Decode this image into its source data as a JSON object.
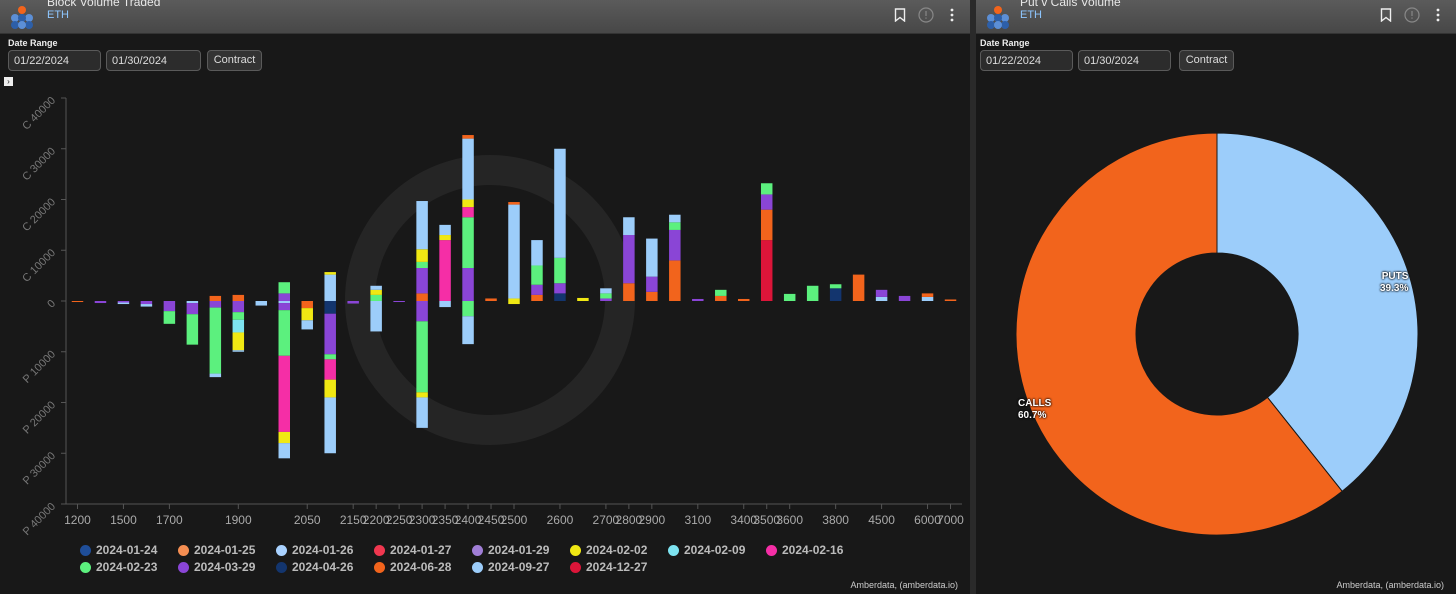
{
  "left_panel": {
    "title": "Block Volume Traded",
    "subtitle": "ETH",
    "date_range_label": "Date Range",
    "start_date": "01/22/2024",
    "end_date": "01/30/2024",
    "contract_button": "Contract",
    "expander": "›",
    "credit": "Amberdata, (amberdata.io)"
  },
  "right_panel": {
    "title": "Put v Calls Volume",
    "subtitle": "ETH",
    "date_range_label": "Date Range",
    "start_date": "01/22/2024",
    "end_date": "01/30/2024",
    "contract_button": "Contract",
    "credit": "Amberdata, (amberdata.io)"
  },
  "icons": [
    "logo-icon",
    "bookmark-icon",
    "info-icon",
    "more-vertical-icon"
  ],
  "chart_data": [
    {
      "type": "bar",
      "stacked": true,
      "ylabel_ticks": [
        "C 40000",
        "C 30000",
        "C 20000",
        "C 10000",
        "0",
        "P 10000",
        "P 20000",
        "P 30000",
        "P 40000"
      ],
      "ylim": [
        -40000,
        40000
      ],
      "categories": [
        "1200",
        "1300",
        "1500",
        "1600",
        "1700",
        "1800",
        "1850",
        "1900",
        "1950",
        "2000",
        "2050",
        "2100",
        "2150",
        "2200",
        "2250",
        "2300",
        "2350",
        "2400",
        "2450",
        "2500",
        "2550",
        "2600",
        "2650",
        "2700",
        "2800",
        "2900",
        "3000",
        "3100",
        "3200",
        "3400",
        "3500",
        "3600",
        "3700",
        "3800",
        "4000",
        "4500",
        "5000",
        "6000",
        "7000"
      ],
      "x_tick_labels": [
        "1200",
        "1500",
        "1700",
        "1900",
        "2050",
        "2150",
        "2200",
        "2250",
        "2300",
        "2350",
        "2400",
        "2450",
        "2500",
        "2600",
        "2700",
        "2800",
        "2900",
        "3100",
        "3400",
        "3500",
        "3600",
        "3800",
        "4500",
        "6000",
        "7000"
      ],
      "expiries": [
        "2024-01-24",
        "2024-01-25",
        "2024-01-26",
        "2024-01-27",
        "2024-01-29",
        "2024-02-02",
        "2024-02-09",
        "2024-02-16",
        "2024-02-23",
        "2024-03-29",
        "2024-04-26",
        "2024-06-28",
        "2024-09-27",
        "2024-12-27"
      ],
      "colors": {
        "2024-01-24": "#1f4e99",
        "2024-01-25": "#f58e52",
        "2024-01-26": "#a9d2ff",
        "2024-01-27": "#f0374f",
        "2024-01-29": "#a07ed6",
        "2024-02-02": "#f0e813",
        "2024-02-09": "#7de3f0",
        "2024-02-16": "#f52ea6",
        "2024-02-23": "#5cf07e",
        "2024-03-29": "#8a45d6",
        "2024-04-26": "#13356e",
        "2024-06-28": "#f2641c",
        "2024-09-27": "#9ccdfa",
        "2024-12-27": "#dc1539"
      },
      "bars": [
        {
          "x": "1200",
          "calls": [],
          "puts": [
            [
              "2024-06-28",
              200
            ]
          ]
        },
        {
          "x": "1300",
          "calls": [],
          "puts": [
            [
              "2024-03-29",
              400
            ]
          ]
        },
        {
          "x": "1500",
          "calls": [],
          "puts": [
            [
              "2024-03-29",
              300
            ],
            [
              "2024-09-27",
              300
            ]
          ]
        },
        {
          "x": "1600",
          "calls": [],
          "puts": [
            [
              "2024-03-29",
              600
            ],
            [
              "2024-09-27",
              500
            ]
          ]
        },
        {
          "x": "1700",
          "calls": [],
          "puts": [
            [
              "2024-03-29",
              2000
            ],
            [
              "2024-02-23",
              2500
            ]
          ]
        },
        {
          "x": "1800",
          "calls": [],
          "puts": [
            [
              "2024-09-27",
              400
            ],
            [
              "2024-03-29",
              2200
            ],
            [
              "2024-02-23",
              6000
            ]
          ]
        },
        {
          "x": "1850",
          "calls": [
            [
              "2024-06-28",
              1000
            ]
          ],
          "puts": [
            [
              "2024-03-29",
              1300
            ],
            [
              "2024-02-23",
              13000
            ],
            [
              "2024-09-27",
              700
            ]
          ]
        },
        {
          "x": "1900",
          "calls": [
            [
              "2024-06-28",
              1200
            ]
          ],
          "puts": [
            [
              "2024-03-29",
              2200
            ],
            [
              "2024-02-23",
              1500
            ],
            [
              "2024-02-09",
              2500
            ],
            [
              "2024-02-02",
              3500
            ],
            [
              "2024-09-27",
              300
            ]
          ]
        },
        {
          "x": "1950",
          "calls": [],
          "puts": [
            [
              "2024-09-27",
              900
            ]
          ]
        },
        {
          "x": "2000",
          "calls": [
            [
              "2024-03-29",
              1500
            ],
            [
              "2024-02-23",
              2200
            ]
          ],
          "puts": [
            [
              "2024-09-27",
              400
            ],
            [
              "2024-03-29",
              1400
            ],
            [
              "2024-02-23",
              9000
            ],
            [
              "2024-02-16",
              15000
            ],
            [
              "2024-02-02",
              2200
            ],
            [
              "2024-09-27",
              3000
            ]
          ]
        },
        {
          "x": "2050",
          "calls": [],
          "puts": [
            [
              "2024-06-28",
              1400
            ],
            [
              "2024-02-02",
              2400
            ],
            [
              "2024-09-27",
              1800
            ]
          ]
        },
        {
          "x": "2100",
          "calls": [
            [
              "2024-09-27",
              5200
            ],
            [
              "2024-02-02",
              500
            ]
          ],
          "puts": [
            [
              "2024-04-26",
              2500
            ],
            [
              "2024-03-29",
              8000
            ],
            [
              "2024-02-23",
              1000
            ],
            [
              "2024-02-16",
              4000
            ],
            [
              "2024-02-02",
              3500
            ],
            [
              "2024-09-27",
              11000
            ]
          ]
        },
        {
          "x": "2150",
          "calls": [],
          "puts": [
            [
              "2024-03-29",
              500
            ]
          ]
        },
        {
          "x": "2200",
          "calls": [
            [
              "2024-02-23",
              1200
            ],
            [
              "2024-02-02",
              1000
            ],
            [
              "2024-09-27",
              800
            ]
          ],
          "puts": [
            [
              "2024-09-27",
              6000
            ]
          ]
        },
        {
          "x": "2250",
          "calls": [],
          "puts": [
            [
              "2024-03-29",
              200
            ]
          ]
        },
        {
          "x": "2300",
          "calls": [
            [
              "2024-06-28",
              1500
            ],
            [
              "2024-03-29",
              5000
            ],
            [
              "2024-02-23",
              1200
            ],
            [
              "2024-02-02",
              2500
            ],
            [
              "2024-09-27",
              9500
            ]
          ],
          "puts": [
            [
              "2024-03-29",
              4000
            ],
            [
              "2024-02-23",
              14000
            ],
            [
              "2024-02-02",
              1000
            ],
            [
              "2024-09-27",
              6000
            ]
          ]
        },
        {
          "x": "2350",
          "calls": [
            [
              "2024-02-16",
              12000
            ],
            [
              "2024-02-02",
              1000
            ],
            [
              "2024-09-27",
              2000
            ]
          ],
          "puts": [
            [
              "2024-09-27",
              1200
            ]
          ]
        },
        {
          "x": "2400",
          "calls": [
            [
              "2024-03-29",
              6500
            ],
            [
              "2024-02-23",
              10000
            ],
            [
              "2024-02-16",
              2000
            ],
            [
              "2024-02-02",
              1500
            ],
            [
              "2024-09-27",
              12000
            ],
            [
              "2024-06-28",
              700
            ]
          ],
          "puts": [
            [
              "2024-02-23",
              3000
            ],
            [
              "2024-09-27",
              5500
            ]
          ]
        },
        {
          "x": "2450",
          "calls": [
            [
              "2024-06-28",
              500
            ]
          ],
          "puts": []
        },
        {
          "x": "2500",
          "calls": [
            [
              "2024-02-02",
              500
            ],
            [
              "2024-09-27",
              18500
            ],
            [
              "2024-06-28",
              500
            ]
          ],
          "puts": [
            [
              "2024-02-02",
              600
            ]
          ]
        },
        {
          "x": "2550",
          "calls": [
            [
              "2024-06-28",
              1200
            ],
            [
              "2024-03-29",
              2000
            ],
            [
              "2024-02-23",
              3800
            ],
            [
              "2024-09-27",
              5000
            ]
          ],
          "puts": []
        },
        {
          "x": "2600",
          "calls": [
            [
              "2024-04-26",
              1500
            ],
            [
              "2024-03-29",
              2000
            ],
            [
              "2024-02-23",
              5000
            ],
            [
              "2024-09-27",
              21500
            ]
          ],
          "puts": []
        },
        {
          "x": "2650",
          "calls": [
            [
              "2024-02-02",
              600
            ]
          ],
          "puts": []
        },
        {
          "x": "2700",
          "calls": [
            [
              "2024-03-29",
              500
            ],
            [
              "2024-02-23",
              1000
            ],
            [
              "2024-09-27",
              1000
            ]
          ],
          "puts": []
        },
        {
          "x": "2800",
          "calls": [
            [
              "2024-06-28",
              3500
            ],
            [
              "2024-03-29",
              9500
            ],
            [
              "2024-09-27",
              3500
            ]
          ],
          "puts": []
        },
        {
          "x": "2900",
          "calls": [
            [
              "2024-06-28",
              1800
            ],
            [
              "2024-03-29",
              3000
            ],
            [
              "2024-09-27",
              7500
            ]
          ],
          "puts": []
        },
        {
          "x": "3000",
          "calls": [
            [
              "2024-06-28",
              8000
            ],
            [
              "2024-03-29",
              6000
            ],
            [
              "2024-02-23",
              1500
            ],
            [
              "2024-09-27",
              1500
            ]
          ],
          "puts": []
        },
        {
          "x": "3100",
          "calls": [
            [
              "2024-03-29",
              400
            ]
          ],
          "puts": []
        },
        {
          "x": "3200",
          "calls": [
            [
              "2024-06-28",
              1000
            ],
            [
              "2024-02-23",
              1200
            ]
          ],
          "puts": []
        },
        {
          "x": "3400",
          "calls": [
            [
              "2024-06-28",
              400
            ]
          ],
          "puts": []
        },
        {
          "x": "3500",
          "calls": [
            [
              "2024-12-27",
              12000
            ],
            [
              "2024-06-28",
              6000
            ],
            [
              "2024-03-29",
              3000
            ],
            [
              "2024-02-23",
              2200
            ]
          ],
          "puts": []
        },
        {
          "x": "3600",
          "calls": [
            [
              "2024-02-23",
              1400
            ]
          ],
          "puts": []
        },
        {
          "x": "3700",
          "calls": [
            [
              "2024-02-23",
              3000
            ]
          ],
          "puts": []
        },
        {
          "x": "3800",
          "calls": [
            [
              "2024-04-26",
              2500
            ],
            [
              "2024-02-23",
              800
            ]
          ],
          "puts": []
        },
        {
          "x": "4000",
          "calls": [
            [
              "2024-06-28",
              5200
            ]
          ],
          "puts": []
        },
        {
          "x": "4500",
          "calls": [
            [
              "2024-09-27",
              800
            ],
            [
              "2024-03-29",
              1400
            ]
          ],
          "puts": []
        },
        {
          "x": "5000",
          "calls": [
            [
              "2024-03-29",
              1000
            ]
          ],
          "puts": []
        },
        {
          "x": "6000",
          "calls": [
            [
              "2024-09-27",
              800
            ],
            [
              "2024-06-28",
              700
            ]
          ],
          "puts": []
        },
        {
          "x": "7000",
          "calls": [
            [
              "2024-06-28",
              300
            ]
          ],
          "puts": []
        }
      ]
    },
    {
      "type": "pie",
      "donut": true,
      "slices": [
        {
          "label": "PUTS",
          "value": 39.3,
          "display": "39.3%",
          "color": "#9ccdfa"
        },
        {
          "label": "CALLS",
          "value": 60.7,
          "display": "60.7%",
          "color": "#f2641c"
        }
      ]
    }
  ]
}
